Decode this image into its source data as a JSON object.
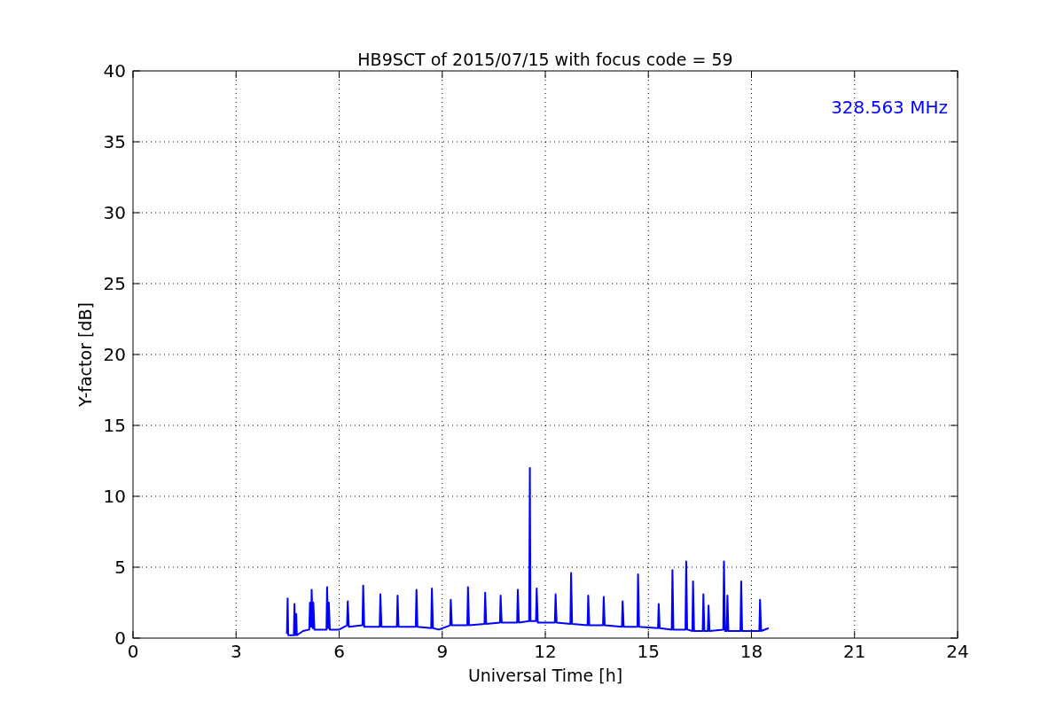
{
  "chart_data": {
    "type": "line",
    "title": "HB9SCT of 2015/07/15 with focus code = 59",
    "xlabel": "Universal Time [h]",
    "ylabel": "Y-factor [dB]",
    "x": [
      4.48,
      4.5,
      4.52,
      4.68,
      4.7,
      4.72,
      4.75,
      4.77,
      4.95,
      5.13,
      5.15,
      5.18,
      5.2,
      5.23,
      5.25,
      5.28,
      5.63,
      5.65,
      5.68,
      5.7,
      5.73,
      6.0,
      6.23,
      6.25,
      6.28,
      6.68,
      6.7,
      6.73,
      7.18,
      7.2,
      7.23,
      7.68,
      7.7,
      7.73,
      8.23,
      8.25,
      8.28,
      8.68,
      8.7,
      8.73,
      8.9,
      9.23,
      9.25,
      9.28,
      9.73,
      9.75,
      9.78,
      10.23,
      10.25,
      10.28,
      10.68,
      10.7,
      10.73,
      11.18,
      11.2,
      11.23,
      11.53,
      11.55,
      11.57,
      11.73,
      11.75,
      11.78,
      12.28,
      12.3,
      12.33,
      12.73,
      12.75,
      12.78,
      13.23,
      13.25,
      13.28,
      13.68,
      13.7,
      13.73,
      14.23,
      14.25,
      14.28,
      14.68,
      14.7,
      14.73,
      15.28,
      15.3,
      15.33,
      15.68,
      15.7,
      15.73,
      16.08,
      16.1,
      16.13,
      16.28,
      16.3,
      16.33,
      16.58,
      16.6,
      16.63,
      16.73,
      16.75,
      16.78,
      17.18,
      17.2,
      17.23,
      17.28,
      17.3,
      17.33,
      17.68,
      17.7,
      17.73,
      18.23,
      18.25,
      18.28,
      18.5
    ],
    "series": [
      {
        "color": "#0000ff",
        "values": [
          0.3,
          2.8,
          0.2,
          0.2,
          2.4,
          0.2,
          1.7,
          0.2,
          0.5,
          0.6,
          2.5,
          0.8,
          3.4,
          0.7,
          2.5,
          0.6,
          0.6,
          3.6,
          0.7,
          2.5,
          0.6,
          0.6,
          0.9,
          2.6,
          0.8,
          0.9,
          3.7,
          0.8,
          0.8,
          3.1,
          0.8,
          0.8,
          3.0,
          0.8,
          0.8,
          3.4,
          0.8,
          0.7,
          3.5,
          0.7,
          0.6,
          0.9,
          2.7,
          0.9,
          0.9,
          3.6,
          0.9,
          1.0,
          3.2,
          1.0,
          1.1,
          3.0,
          1.1,
          1.1,
          3.4,
          1.1,
          1.2,
          12.0,
          1.2,
          1.2,
          3.5,
          1.1,
          1.1,
          3.1,
          1.1,
          1.0,
          4.6,
          1.0,
          0.9,
          3.0,
          0.9,
          0.9,
          2.9,
          0.9,
          0.8,
          2.6,
          0.8,
          0.8,
          4.5,
          0.8,
          0.7,
          2.4,
          0.7,
          0.6,
          4.8,
          0.6,
          0.6,
          5.4,
          0.6,
          0.5,
          4.0,
          0.5,
          0.5,
          3.1,
          0.5,
          0.5,
          2.3,
          0.5,
          0.6,
          5.4,
          0.5,
          0.5,
          3.0,
          0.5,
          0.5,
          4.0,
          0.5,
          0.5,
          2.7,
          0.5,
          0.7
        ]
      }
    ],
    "xlim": [
      0,
      24
    ],
    "ylim": [
      0,
      40
    ],
    "xticks": [
      0,
      3,
      6,
      9,
      12,
      15,
      18,
      21,
      24
    ],
    "yticks": [
      0,
      5,
      10,
      15,
      20,
      25,
      30,
      35,
      40
    ],
    "grid": true,
    "annotations": [
      {
        "text": "328.563 MHz"
      }
    ]
  }
}
